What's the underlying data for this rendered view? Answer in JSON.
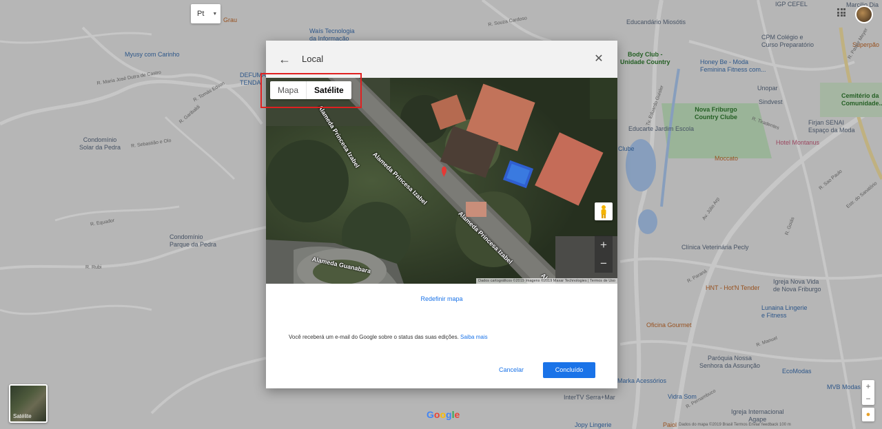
{
  "background_map": {
    "language_button": "Pt",
    "places": [
      {
        "name": "Myusy com Carinho",
        "style": "blue"
      },
      {
        "name": "Condomínio\nSolar da Pedra",
        "style": ""
      },
      {
        "name": "Condomínio\nParque da Pedra",
        "style": ""
      },
      {
        "name": "Waís Tecnologia\nda Informação",
        "style": "blue"
      },
      {
        "name": "Educandário Miosótis",
        "style": ""
      },
      {
        "name": "Body Club -\nUnidade Country",
        "style": "green"
      },
      {
        "name": "Honey Be - Moda\nFeminina Fitness com...",
        "style": "blue"
      },
      {
        "name": "CPM Colégio e\nCurso Preparatório",
        "style": ""
      },
      {
        "name": "Unopar",
        "style": ""
      },
      {
        "name": "Sindvest",
        "style": ""
      },
      {
        "name": "Nova Friburgo\nCountry Clube",
        "style": "green"
      },
      {
        "name": "Educarte Jardim Escola",
        "style": ""
      },
      {
        "name": "Firjan SENAI\nEspaço da Moda",
        "style": ""
      },
      {
        "name": "Hotel Montanus",
        "style": "pink"
      },
      {
        "name": "Moccato",
        "style": "orange"
      },
      {
        "name": "Cemitério da\nComunidade...",
        "style": "green"
      },
      {
        "name": "Superpão",
        "style": "orange"
      },
      {
        "name": "IGP CEFEL",
        "style": ""
      },
      {
        "name": "Clínica Veterinária Pecly",
        "style": ""
      },
      {
        "name": "HNT - Hot'N Tender",
        "style": "orange"
      },
      {
        "name": "Igreja Nova Vida\nde Nova Friburgo",
        "style": ""
      },
      {
        "name": "Lunaina Lingerie\ne Fitness",
        "style": "blue"
      },
      {
        "name": "Oficina Gourmet",
        "style": "orange"
      },
      {
        "name": "Paróquia Nossa\nSenhora da Assunção",
        "style": ""
      },
      {
        "name": "EcoModas",
        "style": "blue"
      },
      {
        "name": "Marka Acessórios",
        "style": "blue"
      },
      {
        "name": "MVB Modas",
        "style": "blue"
      },
      {
        "name": "Vidra Som",
        "style": "blue"
      },
      {
        "name": "InterTV Serra+Mar",
        "style": ""
      },
      {
        "name": "Igreja Internacional\nAgape",
        "style": ""
      },
      {
        "name": "Jopy Lingerie",
        "style": "blue"
      },
      {
        "name": "Paiol",
        "style": "orange"
      },
      {
        "name": "DEFUMA\nTENDA",
        "style": "blue"
      },
      {
        "name": "Grau",
        "style": "orange"
      },
      {
        "name": "Clube",
        "style": "blue"
      },
      {
        "name": "Marcilio Dia",
        "style": ""
      }
    ],
    "streets": [
      "R. Maria José Dutra de Castro",
      "R. Tomás Edson",
      "R. Garibaldi",
      "R. Sebastião e Olo",
      "R. Equador",
      "R. Rubi",
      "R. Souza Cardoso",
      "Av. Júlio Arp",
      "Tv. Eduardo Guisler",
      "R. Tiradentes",
      "R. Sao Paulo",
      "R. Goiás",
      "R. Paraná",
      "R. Pernambuco",
      "R. Manuel",
      "R. Pastor Meyer",
      "Estr. do Sanatório"
    ],
    "satellite_thumbnail": "Satélite",
    "google_logo": "Google",
    "footer": "Dados do mapa ©2019   Brasil   Termos   Enviar feedback   100 m",
    "zoom_in": "+",
    "zoom_out": "−"
  },
  "dialog": {
    "title": "Local",
    "map_type": {
      "map_label": "Mapa",
      "satellite_label": "Satélite",
      "selected": "Satélite"
    },
    "satellite_map": {
      "street_labels": [
        "Alameda Princesa Izabel",
        "Alameda Princesa Izabel",
        "Alameda Guanabara",
        "Alameda Princesa Izabel",
        "Al"
      ],
      "attribution": "Dados cartográficos ©2019 Imagens ©2019 Maxar Technologies | Termos de Uso",
      "zoom_in": "+",
      "zoom_out": "−"
    },
    "reset_link": "Redefinir mapa",
    "note_text": "Você receberá um e-mail do Google sobre o status das suas edições.",
    "note_link": "Saiba mais",
    "cancel_label": "Cancelar",
    "done_label": "Concluído"
  },
  "colors": {
    "accent": "#1a73e8",
    "highlight": "#e02020",
    "pin": "#e53935"
  }
}
